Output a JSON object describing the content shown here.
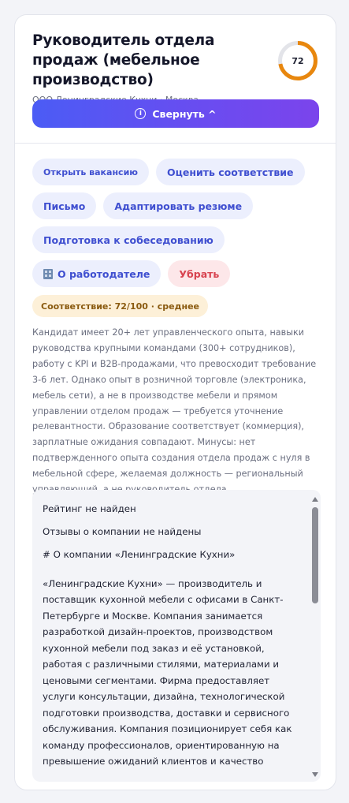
{
  "header": {
    "title": "Руководитель отдела продаж (мебельное производство)",
    "company_line": "ООО Ленинградские Кухни · Москва",
    "score": "72",
    "score_fraction": 0.72,
    "score_color": "#e8870e",
    "collapse_label": "Свернуть ^"
  },
  "actions": {
    "open_vacancy": "Открыть вакансию",
    "assess_fit": "Оценить соответствие",
    "letter": "Письмо",
    "adapt_resume": "Адаптировать резюме",
    "interview_prep": "Подготовка к собеседованию",
    "about_employer": "О работодателе",
    "remove": "Убрать"
  },
  "match_badge": "Соответствие: 72/100 · среднее",
  "summary": "Кандидат имеет 20+ лет управленческого опыта, навыки руководства крупными командами (300+ сотрудников), работу с KPI и B2B-продажами, что превосходит требование 3-6 лет. Однако опыт в розничной торговле (электроника, мебель сети), а не в производстве мебели и прямом управлении отделом продаж — требуется уточнение релевантности. Образование соответствует (коммерция), зарплатные ожидания совпадают. Минусы: нет подтвержденного опыта создания отдела продаж с нуля в мебельной сфере, желаемая должность — региональный управляющий, а не руководитель отдела.",
  "employer_info": {
    "rating": "Рейтинг не найден",
    "reviews": "Отзывы о компании не найдены",
    "heading": "# О компании «Ленинградские Кухни»",
    "body": "«Ленинградские Кухни» — производитель и поставщик кухонной мебели с офисами в Санкт-Петербурге и Москве. Компания занимается разработкой дизайн-проектов, производством кухонной мебели под заказ и её установкой, работая с различными стилями, материалами и ценовыми сегментами. Фирма предоставляет услуги консультации, дизайна, технологической подготовки производства, доставки и сервисного обслуживания. Компания позиционирует себя как команду профессионалов, ориентированную на превышение ожиданий клиентов и качество"
  }
}
